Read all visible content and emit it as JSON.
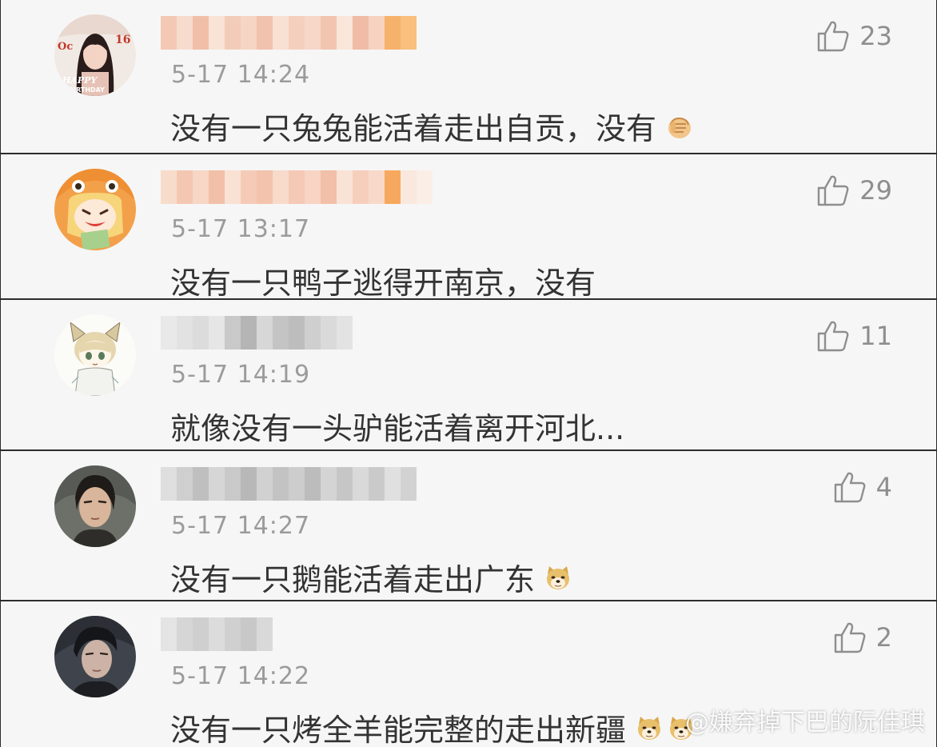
{
  "comments": [
    {
      "avatar": "avatar-happy-birthday-portrait",
      "avatar_text": "HAPPY BIRTHDAY",
      "time": "5-17 14:24",
      "text": "没有一只兔兔能活着走出自贡，没有",
      "emoji": "fist-emoji",
      "likes": "23",
      "blur_colors": [
        "#f3c8b4",
        "#f7dccd",
        "#f1bfa8",
        "#f8e3d6",
        "#f3ccb9",
        "#f6d5c4",
        "#f1c2ad",
        "#f8e0d2",
        "#f4cfbe",
        "#f7d7c8",
        "#f2c5b1",
        "#f9e5d9",
        "#f0bca5",
        "#f6d3c1",
        "#f6b26b",
        "#f8c07c"
      ]
    },
    {
      "avatar": "avatar-anime-orange-hood",
      "time": "5-17 13:17",
      "text": "没有一只鸭子逃得开南京，没有",
      "emoji": "",
      "likes": "29",
      "blur_colors": [
        "#f8dccb",
        "#f4c7b2",
        "#f7d6c5",
        "#f2c0a9",
        "#f9e1d3",
        "#f5cbb7",
        "#f3c3ad",
        "#f8dacb",
        "#f4c9b5",
        "#f7d4c3",
        "#f2bfa8",
        "#f9e3d6",
        "#f6cebc",
        "#f8d9c9",
        "#f6a95e",
        "#f9e8dd",
        "#fbeee6"
      ]
    },
    {
      "avatar": "avatar-anime-cat-ears",
      "time": "5-17 14:19",
      "text": "就像没有一头驴能活着离开河北...",
      "emoji": "",
      "likes": "11",
      "blur_colors": [
        "#e9e9e9",
        "#e2e2e2",
        "#dcdcdc",
        "#e6e6e6",
        "#c9c9c9",
        "#b5b5b5",
        "#d7d7d7",
        "#c4c4c4",
        "#bdbdbd",
        "#cfcfcf",
        "#dadada",
        "#e3e3e3"
      ]
    },
    {
      "avatar": "avatar-man-portrait",
      "time": "5-17 14:27",
      "text": "没有一只鹅能活着走出广东",
      "emoji": "doge-emoji",
      "likes": "4",
      "blur_colors": [
        "#dedede",
        "#cfcfcf",
        "#bfbfbf",
        "#d6d6d6",
        "#c9c9c9",
        "#b8b8b8",
        "#d1d1d1",
        "#c3c3c3",
        "#cdcdcd",
        "#bcbcbc",
        "#d4d4d4",
        "#c6c6c6",
        "#d9d9d9",
        "#cacaca",
        "#e0e0e0",
        "#d2d2d2"
      ]
    },
    {
      "avatar": "avatar-young-man-portrait",
      "time": "5-17 14:22",
      "text": "没有一只烤全羊能完整的走出新疆",
      "emoji": "doge-emoji",
      "emoji2": "doge-emoji",
      "likes": "2",
      "blur_colors": [
        "#e4e4e4",
        "#d6d6d6",
        "#cfcfcf",
        "#dcdcdc",
        "#d0d0d0",
        "#c8c8c8",
        "#d9d9d9"
      ]
    }
  ],
  "watermark": "@嫌弃掉下巴的阮佳琪"
}
